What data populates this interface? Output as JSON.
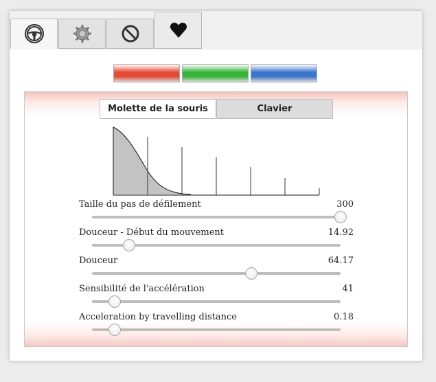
{
  "toolbar": {
    "tabs": [
      {
        "name": "steering-wheel-icon"
      },
      {
        "name": "gear-icon"
      },
      {
        "name": "prohibited-icon"
      },
      {
        "name": "heart-icon"
      }
    ],
    "active_tab": 0
  },
  "color_swatches": [
    {
      "name": "red-swatch",
      "color": "#e64a35"
    },
    {
      "name": "green-swatch",
      "color": "#35b53a"
    },
    {
      "name": "blue-swatch",
      "color": "#3a76cc"
    }
  ],
  "panel": {
    "tabs": [
      {
        "label": "Molette de la souris",
        "active": true
      },
      {
        "label": "Clavier",
        "active": false
      }
    ]
  },
  "sliders": [
    {
      "label": "Taille du pas de défilement",
      "value": "300",
      "level": 1.0
    },
    {
      "label": "Douceur - Début du mouvement",
      "value": "14.92",
      "level": 0.15
    },
    {
      "label": "Douceur",
      "value": "64.17",
      "level": 0.64
    },
    {
      "label": "Sensibilité de l'accélération",
      "value": "41",
      "level": 0.09
    },
    {
      "label": "Acceleration by travelling distance",
      "value": "0.18",
      "level": 0.09
    }
  ]
}
